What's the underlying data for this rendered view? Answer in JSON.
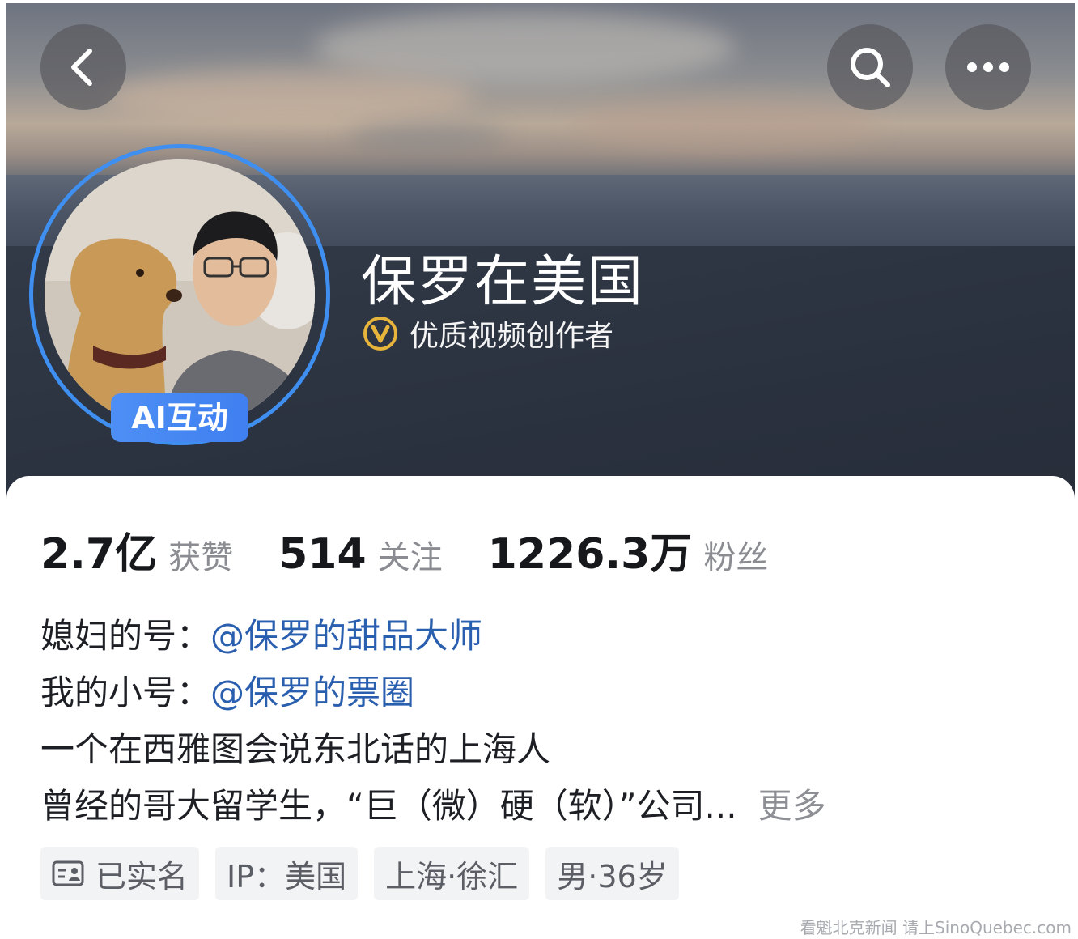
{
  "header": {
    "back_icon": "chevron-left-icon",
    "search_icon": "search-icon",
    "more_icon": "more-dots-icon"
  },
  "profile": {
    "name": "保罗在美国",
    "ai_badge": "AI互动",
    "certification": "优质视频创作者",
    "cert_icon": "verified-v-icon",
    "cert_color": "#e7b43c"
  },
  "stats": [
    {
      "value": "2.7亿",
      "label": "获赞"
    },
    {
      "value": "514",
      "label": "关注"
    },
    {
      "value": "1226.3万",
      "label": "粉丝"
    }
  ],
  "bio": {
    "line1_prefix": "媳妇的号：",
    "line1_mention": "@保罗的甜品大师",
    "line2_prefix": "我的小号：",
    "line2_mention": "@保罗的票圈",
    "line3": "一个在西雅图会说东北话的上海人",
    "line4": "曾经的哥大留学生，“巨（微）硬（软）”公司...",
    "more": "更多"
  },
  "tags": {
    "verified": "已实名",
    "ip": "IP：美国",
    "location": "上海·徐汇",
    "gender_age": "男·36岁"
  },
  "watermark": "看魁北克新闻 请上SinoQuebec.com",
  "colors": {
    "accent_blue": "#3f8ff0",
    "mention_blue": "#2a5fb0"
  }
}
